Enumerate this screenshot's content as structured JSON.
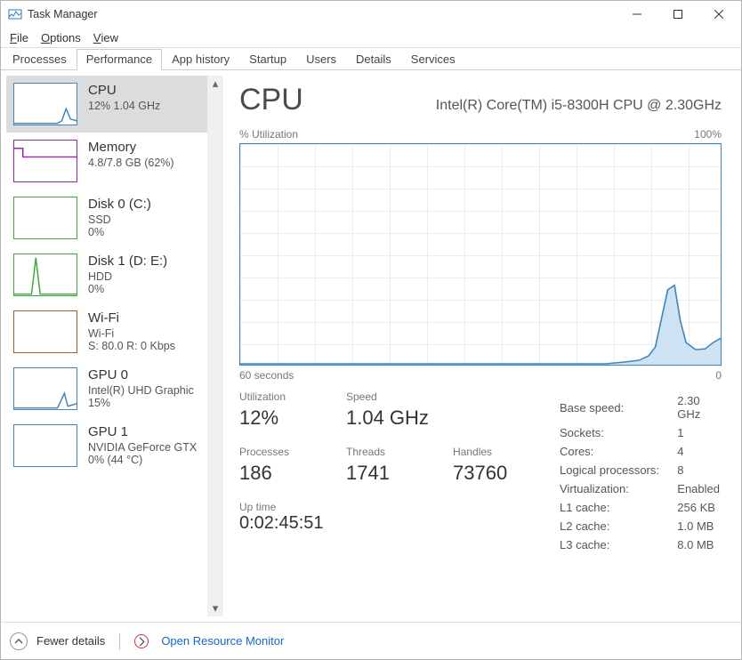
{
  "window": {
    "title": "Task Manager"
  },
  "menu": {
    "file": "File",
    "options": "Options",
    "view": "View"
  },
  "tabs": {
    "processes": "Processes",
    "performance": "Performance",
    "app_history": "App history",
    "startup": "Startup",
    "users": "Users",
    "details": "Details",
    "services": "Services"
  },
  "sidebar": {
    "items": [
      {
        "title": "CPU",
        "sub": "12%  1.04 GHz",
        "color": "#3f86bd"
      },
      {
        "title": "Memory",
        "sub": "4.8/7.8 GB (62%)",
        "color": "#a020b0"
      },
      {
        "title": "Disk 0 (C:)",
        "sub1": "SSD",
        "sub2": "0%",
        "color": "#3ca83c"
      },
      {
        "title": "Disk 1 (D: E:)",
        "sub1": "HDD",
        "sub2": "0%",
        "color": "#3ca83c"
      },
      {
        "title": "Wi-Fi",
        "sub1": "Wi-Fi",
        "sub2": "S: 80.0  R: 0 Kbps",
        "color": "#a25a1e"
      },
      {
        "title": "GPU 0",
        "sub1": "Intel(R) UHD Graphic",
        "sub2": "15%",
        "color": "#3f86bd"
      },
      {
        "title": "GPU 1",
        "sub1": "NVIDIA GeForce GTX",
        "sub2": "0% (44 °C)",
        "color": "#3f86bd"
      }
    ]
  },
  "cpu": {
    "title": "CPU",
    "name": "Intel(R) Core(TM) i5-8300H CPU @ 2.30GHz",
    "graph_label": "% Utilization",
    "graph_max": "100%",
    "x_left": "60 seconds",
    "x_right": "0",
    "metrics": {
      "utilization_label": "Utilization",
      "utilization": "12%",
      "speed_label": "Speed",
      "speed": "1.04 GHz",
      "processes_label": "Processes",
      "processes": "186",
      "threads_label": "Threads",
      "threads": "1741",
      "handles_label": "Handles",
      "handles": "73760",
      "uptime_label": "Up time",
      "uptime": "0:02:45:51"
    },
    "specs": {
      "base_speed_label": "Base speed:",
      "base_speed": "2.30 GHz",
      "sockets_label": "Sockets:",
      "sockets": "1",
      "cores_label": "Cores:",
      "cores": "4",
      "logical_label": "Logical processors:",
      "logical": "8",
      "virtualization_label": "Virtualization:",
      "virtualization": "Enabled",
      "l1_label": "L1 cache:",
      "l1": "256 KB",
      "l2_label": "L2 cache:",
      "l2": "1.0 MB",
      "l3_label": "L3 cache:",
      "l3": "8.0 MB"
    }
  },
  "footer": {
    "fewer": "Fewer details",
    "resmon": "Open Resource Monitor"
  },
  "chart_data": {
    "type": "line",
    "title": "% Utilization",
    "xlabel": "seconds",
    "ylabel": "% Utilization",
    "xlim": [
      60,
      0
    ],
    "ylim": [
      0,
      100
    ],
    "x": [
      60,
      55,
      50,
      45,
      40,
      35,
      30,
      25,
      20,
      15,
      12,
      10,
      8,
      6,
      5,
      4,
      3,
      2,
      1,
      0
    ],
    "values": [
      1,
      1,
      1,
      1,
      1,
      1,
      1,
      1,
      1,
      2,
      3,
      4,
      5,
      10,
      30,
      35,
      12,
      8,
      7,
      12
    ]
  }
}
